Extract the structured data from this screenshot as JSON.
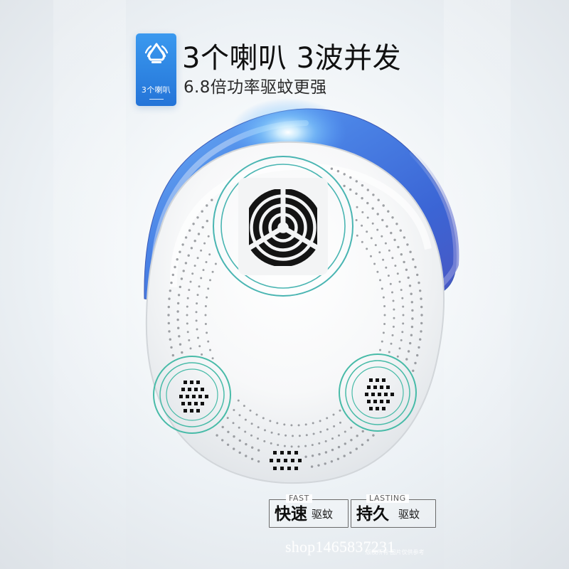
{
  "badge": {
    "icon": "speaker-alarm-icon",
    "label": "3个喇叭"
  },
  "headline": {
    "title": "3个喇叭 3波并发",
    "subtitle": "6.8倍功率驱蚊更强"
  },
  "features": [
    {
      "english": "FAST",
      "main": "快速",
      "side": "驱蚊"
    },
    {
      "english": "LASTING",
      "main": "持久",
      "side": "驱蚊"
    }
  ],
  "watermark": {
    "shop": "shop1465837231",
    "small": "版权所有 图片仅供参考"
  },
  "colors": {
    "badge_blue": "#2f86e5",
    "light_blue": "#69b7ff",
    "device_white": "#f7f7f7",
    "teal_ring": "#37b9a9",
    "speaker_black": "#151515"
  }
}
